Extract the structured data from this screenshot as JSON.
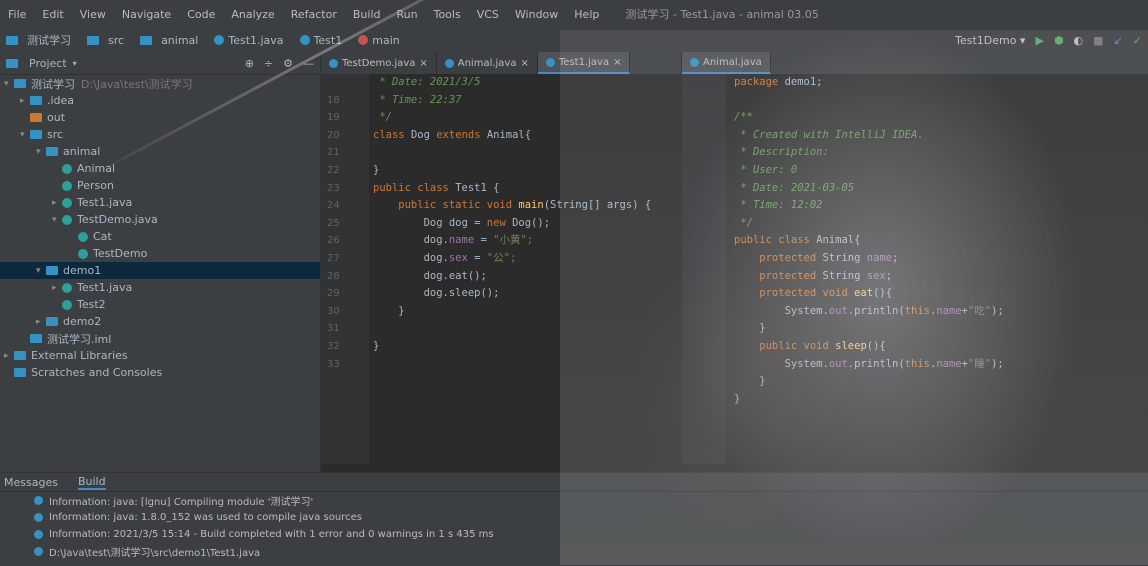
{
  "menu": [
    "File",
    "Edit",
    "View",
    "Navigate",
    "Code",
    "Analyze",
    "Refactor",
    "Build",
    "Run",
    "Tools",
    "VCS",
    "Window",
    "Help"
  ],
  "window_title": "测试学习 - Test1.java - animal 03.05",
  "breadcrumb": [
    {
      "label": "测试学习",
      "kind": "folder"
    },
    {
      "label": "src",
      "kind": "folder"
    },
    {
      "label": "animal",
      "kind": "folder"
    },
    {
      "label": "Test1.java",
      "kind": "class"
    },
    {
      "label": "Test1",
      "kind": "class"
    },
    {
      "label": "main",
      "kind": "method"
    }
  ],
  "run_config": "Test1Demo",
  "project_panel": {
    "title": "Project",
    "rows": [
      {
        "indent": 0,
        "arrow": "▾",
        "icon": "folder",
        "label": "测试学习",
        "extra": "D:\\Java\\test\\测试学习"
      },
      {
        "indent": 1,
        "arrow": "▸",
        "icon": "folder",
        "label": ".idea"
      },
      {
        "indent": 1,
        "arrow": "",
        "icon": "folder-orange",
        "label": "out"
      },
      {
        "indent": 1,
        "arrow": "▾",
        "icon": "folder",
        "label": "src"
      },
      {
        "indent": 2,
        "arrow": "▾",
        "icon": "folder",
        "label": "animal"
      },
      {
        "indent": 3,
        "arrow": "",
        "icon": "class",
        "label": "Animal"
      },
      {
        "indent": 3,
        "arrow": "",
        "icon": "class",
        "label": "Person"
      },
      {
        "indent": 3,
        "arrow": "▸",
        "icon": "class",
        "label": "Test1.java"
      },
      {
        "indent": 3,
        "arrow": "▾",
        "icon": "class",
        "label": "TestDemo.java"
      },
      {
        "indent": 4,
        "arrow": "",
        "icon": "class",
        "label": "Cat"
      },
      {
        "indent": 4,
        "arrow": "",
        "icon": "class",
        "label": "TestDemo"
      },
      {
        "indent": 2,
        "arrow": "▾",
        "icon": "folder",
        "label": "demo1",
        "selected": true
      },
      {
        "indent": 3,
        "arrow": "▸",
        "icon": "class",
        "label": "Test1.java"
      },
      {
        "indent": 3,
        "arrow": "",
        "icon": "class",
        "label": "Test2"
      },
      {
        "indent": 2,
        "arrow": "▸",
        "icon": "folder",
        "label": "demo2"
      },
      {
        "indent": 1,
        "arrow": "",
        "icon": "file",
        "label": "测试学习.iml"
      },
      {
        "indent": 0,
        "arrow": "▸",
        "icon": "folder",
        "label": "External Libraries"
      },
      {
        "indent": 0,
        "arrow": "",
        "icon": "folder",
        "label": "Scratches and Consoles"
      }
    ]
  },
  "editor_tabs": [
    {
      "label": "TestDemo.java",
      "active": false
    },
    {
      "label": "Animal.java",
      "active": false
    },
    {
      "label": "Test1.java",
      "active": true
    }
  ],
  "right_tabs": [
    {
      "label": "Animal.java",
      "active": true
    }
  ],
  "editor_left": {
    "line_numbers": [
      "",
      "18",
      "19",
      "20",
      "21",
      "22",
      "23",
      "24",
      "25",
      "26",
      "27",
      "28",
      "29",
      "30",
      "31",
      "32",
      "33"
    ],
    "lines": [
      [
        {
          "t": " * Date: 2021/3/5",
          "c": "cm"
        }
      ],
      [
        {
          "t": " * Time: 22:37",
          "c": "cm"
        }
      ],
      [
        {
          "t": " */",
          "c": "cm"
        }
      ],
      [
        {
          "t": "class ",
          "c": "kw"
        },
        {
          "t": "Dog ",
          "c": "plain"
        },
        {
          "t": "extends ",
          "c": "kw"
        },
        {
          "t": "Animal{",
          "c": "plain"
        }
      ],
      [
        {
          "t": "",
          "c": "plain"
        }
      ],
      [
        {
          "t": "}",
          "c": "plain"
        }
      ],
      [
        {
          "t": "public class ",
          "c": "kw"
        },
        {
          "t": "Test1 {",
          "c": "plain"
        }
      ],
      [
        {
          "t": "    public static void ",
          "c": "kw"
        },
        {
          "t": "main",
          "c": "fn"
        },
        {
          "t": "(String[] args) {",
          "c": "plain"
        }
      ],
      [
        {
          "t": "        Dog dog = ",
          "c": "plain"
        },
        {
          "t": "new ",
          "c": "kw"
        },
        {
          "t": "Dog();",
          "c": "plain"
        }
      ],
      [
        {
          "t": "        dog.",
          "c": "plain"
        },
        {
          "t": "name",
          "c": "fld"
        },
        {
          "t": " = ",
          "c": "plain"
        },
        {
          "t": "\"小黄\";",
          "c": "st"
        }
      ],
      [
        {
          "t": "        dog.",
          "c": "plain"
        },
        {
          "t": "sex",
          "c": "fld"
        },
        {
          "t": " = ",
          "c": "plain"
        },
        {
          "t": "\"公\";",
          "c": "st"
        }
      ],
      [
        {
          "t": "        dog.eat();",
          "c": "plain"
        }
      ],
      [
        {
          "t": "        dog.sleep();",
          "c": "plain"
        }
      ],
      [
        {
          "t": "    }",
          "c": "plain"
        }
      ],
      [
        {
          "t": "",
          "c": "plain"
        }
      ],
      [
        {
          "t": "}",
          "c": "plain"
        }
      ]
    ]
  },
  "editor_right": {
    "lines": [
      [
        {
          "t": "package ",
          "c": "kw"
        },
        {
          "t": "demo1;",
          "c": "plain"
        }
      ],
      [
        {
          "t": "",
          "c": "plain"
        }
      ],
      [
        {
          "t": "/**",
          "c": "cm"
        }
      ],
      [
        {
          "t": " * Created with IntelliJ IDEA.",
          "c": "cm"
        }
      ],
      [
        {
          "t": " * Description:",
          "c": "cm"
        }
      ],
      [
        {
          "t": " * User: 0",
          "c": "cm"
        }
      ],
      [
        {
          "t": " * Date: 2021-03-05",
          "c": "cm"
        }
      ],
      [
        {
          "t": " * Time: 12:02",
          "c": "cm"
        }
      ],
      [
        {
          "t": " */",
          "c": "cm"
        }
      ],
      [
        {
          "t": "public class ",
          "c": "kw"
        },
        {
          "t": "Animal{",
          "c": "plain"
        }
      ],
      [
        {
          "t": "    protected ",
          "c": "kw"
        },
        {
          "t": "String ",
          "c": "plain"
        },
        {
          "t": "name",
          "c": "fld"
        },
        {
          "t": ";",
          "c": "plain"
        }
      ],
      [
        {
          "t": "    protected ",
          "c": "kw"
        },
        {
          "t": "String ",
          "c": "plain"
        },
        {
          "t": "sex",
          "c": "fld"
        },
        {
          "t": ";",
          "c": "plain"
        }
      ],
      [
        {
          "t": "    protected void ",
          "c": "kw"
        },
        {
          "t": "eat",
          "c": "fn"
        },
        {
          "t": "(){",
          "c": "plain"
        }
      ],
      [
        {
          "t": "        System.",
          "c": "plain"
        },
        {
          "t": "out",
          "c": "fld"
        },
        {
          "t": ".println(",
          "c": "plain"
        },
        {
          "t": "this",
          "c": "kw"
        },
        {
          "t": ".",
          "c": "plain"
        },
        {
          "t": "name",
          "c": "fld"
        },
        {
          "t": "+",
          "c": "plain"
        },
        {
          "t": "\"吃\"",
          "c": "st"
        },
        {
          "t": ");",
          "c": "plain"
        }
      ],
      [
        {
          "t": "    }",
          "c": "plain"
        }
      ],
      [
        {
          "t": "    public void ",
          "c": "kw"
        },
        {
          "t": "sleep",
          "c": "fn"
        },
        {
          "t": "(){",
          "c": "plain"
        }
      ],
      [
        {
          "t": "        System.",
          "c": "plain"
        },
        {
          "t": "out",
          "c": "fld"
        },
        {
          "t": ".println(",
          "c": "plain"
        },
        {
          "t": "this",
          "c": "kw"
        },
        {
          "t": ".",
          "c": "plain"
        },
        {
          "t": "name",
          "c": "fld"
        },
        {
          "t": "+",
          "c": "plain"
        },
        {
          "t": "\"睡\"",
          "c": "st"
        },
        {
          "t": ");",
          "c": "plain"
        }
      ],
      [
        {
          "t": "    }",
          "c": "plain"
        }
      ],
      [
        {
          "t": "}",
          "c": "plain"
        }
      ]
    ]
  },
  "bottom_panel": {
    "tabs": [
      {
        "label": "Messages",
        "active": false
      },
      {
        "label": "Build",
        "active": true
      }
    ],
    "messages": [
      "Information: java: [lgnu] Compiling module '测试学习'",
      "Information: java: 1.8.0_152 was used to compile java sources",
      "Information: 2021/3/5 15:14 - Build completed with 1 error and 0 warnings in 1 s 435 ms",
      "D:\\Java\\test\\测试学习\\src\\demo1\\Test1.java"
    ]
  },
  "colors": {
    "accent": "#4a88c7",
    "keyword": "#cc7832",
    "comment": "#629755",
    "string": "#6a8759",
    "field": "#9876aa",
    "function": "#ffc66d"
  }
}
